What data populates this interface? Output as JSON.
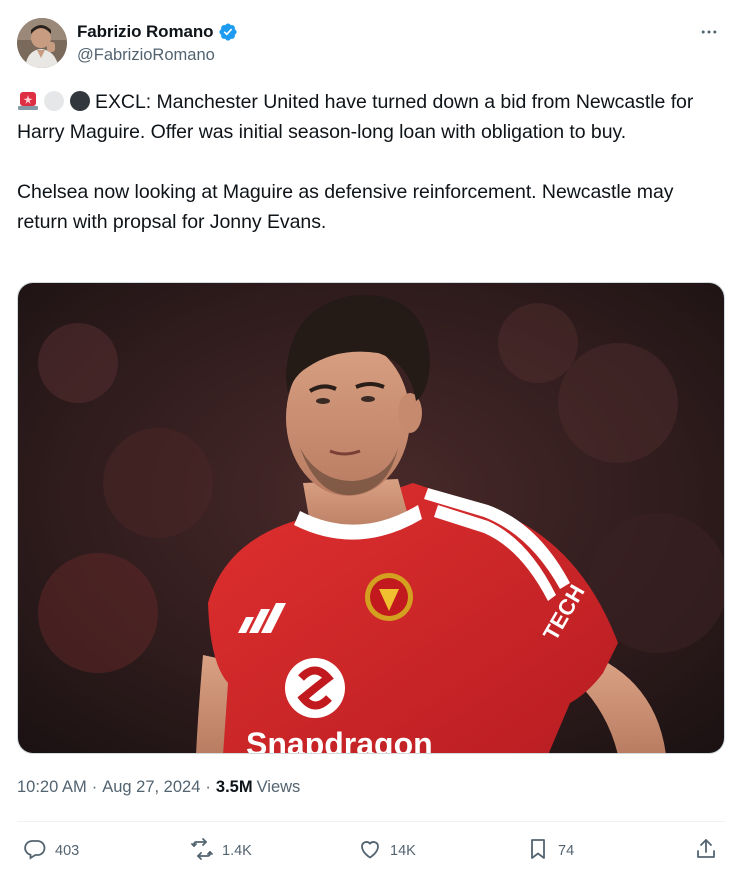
{
  "author": {
    "display_name": "Fabrizio Romano",
    "handle": "@FabrizioRomano",
    "verified_color": "#1d9bf0"
  },
  "tweet": {
    "paragraph1": "EXCL: Manchester United have turned down a bid from Newcastle for Harry Maguire. Offer was initial season-long loan with obligation to buy.",
    "paragraph2": "Chelsea now looking at Maguire as defensive reinforcement. Newcastle may return with propsal for Jonny Evans.",
    "emojis": [
      "police-light-emoji",
      "white-circle-emoji",
      "black-circle-emoji"
    ]
  },
  "media": {
    "sponsor_text": "Snapdragon"
  },
  "meta": {
    "time": "10:20 AM",
    "date": "Aug 27, 2024",
    "views_count": "3.5M",
    "views_label": "Views",
    "separator": "·"
  },
  "actions": {
    "replies": "403",
    "reposts": "1.4K",
    "likes": "14K",
    "bookmarks": "74"
  },
  "colors": {
    "text": "#0f1419",
    "secondary": "#536471",
    "accent": "#1d9bf0",
    "shirt_red": "#d8262a"
  }
}
